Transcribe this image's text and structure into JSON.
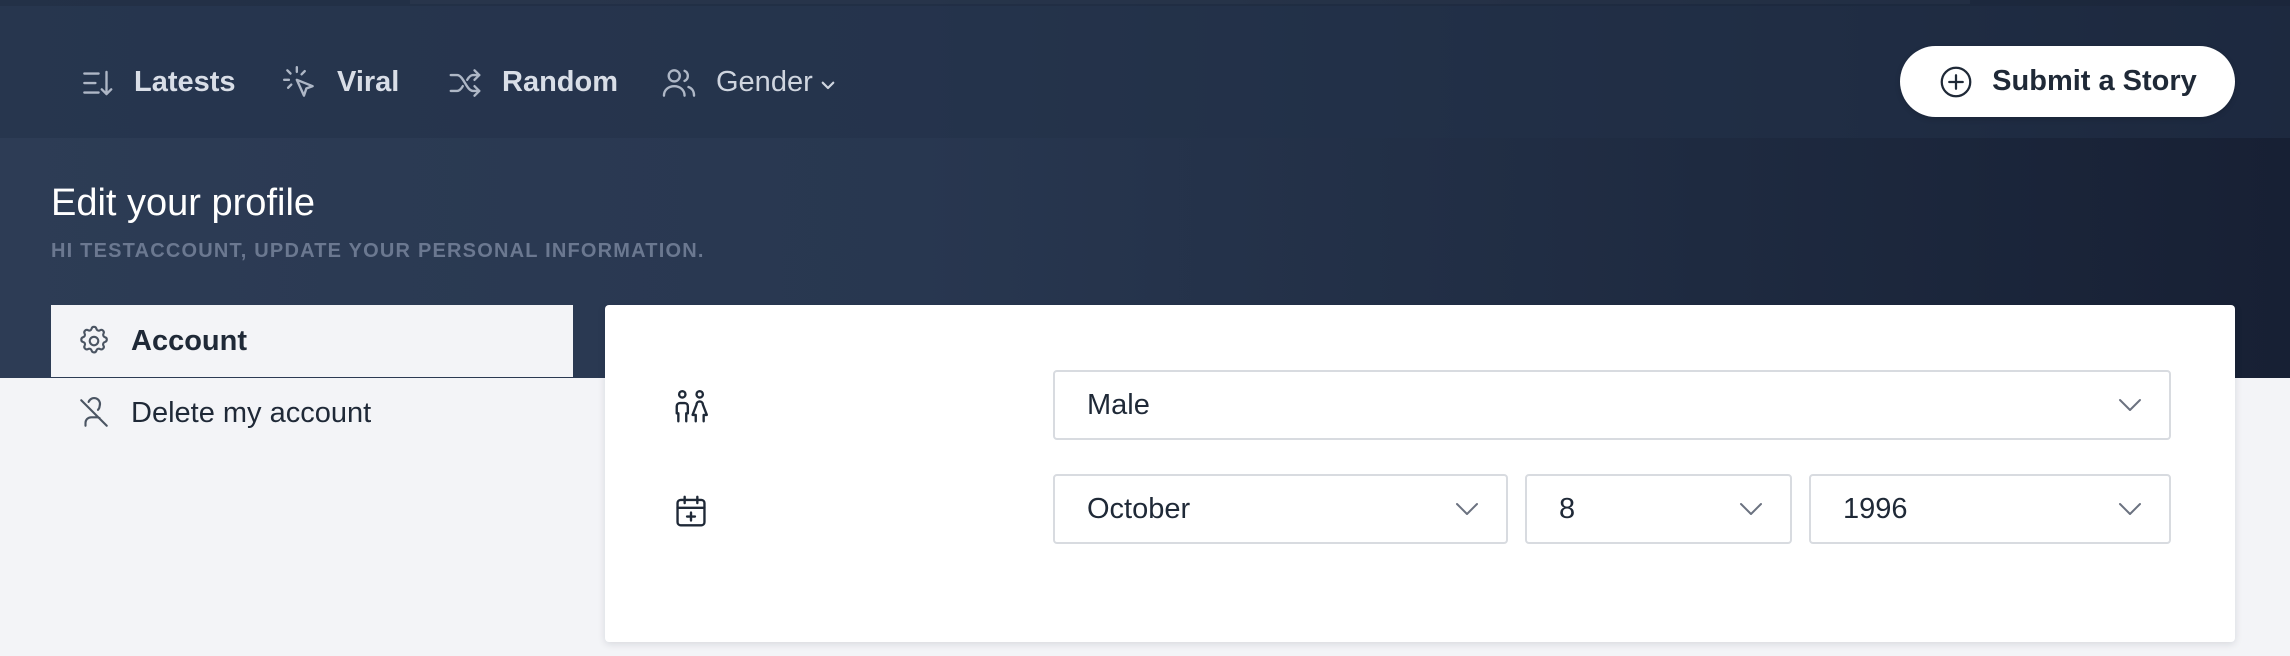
{
  "nav": {
    "items": [
      {
        "label": "Latests",
        "icon": "sort-descending-icon"
      },
      {
        "label": "Viral",
        "icon": "cursor-click-icon"
      },
      {
        "label": "Random",
        "icon": "shuffle-icon"
      }
    ],
    "gender": {
      "label": "Gender",
      "icon": "users-icon"
    },
    "submit_label": "Submit a Story"
  },
  "header": {
    "title": "Edit your profile",
    "subtitle": "HI TESTACCOUNT, UPDATE YOUR PERSONAL INFORMATION."
  },
  "sidebar": {
    "items": [
      {
        "label": "Account",
        "icon": "gear-icon",
        "active": true
      },
      {
        "label": "Delete my account",
        "icon": "user-off-icon",
        "active": false
      }
    ]
  },
  "form": {
    "gender": {
      "icon": "couple-icon",
      "selected": "Male"
    },
    "birthdate": {
      "icon": "calendar-plus-icon",
      "month": "October",
      "day": "8",
      "year": "1996"
    }
  },
  "colors": {
    "hero_start": "#2d3c55",
    "hero_end": "#172034",
    "page_bg": "#f3f4f7",
    "card_bg": "#ffffff"
  }
}
